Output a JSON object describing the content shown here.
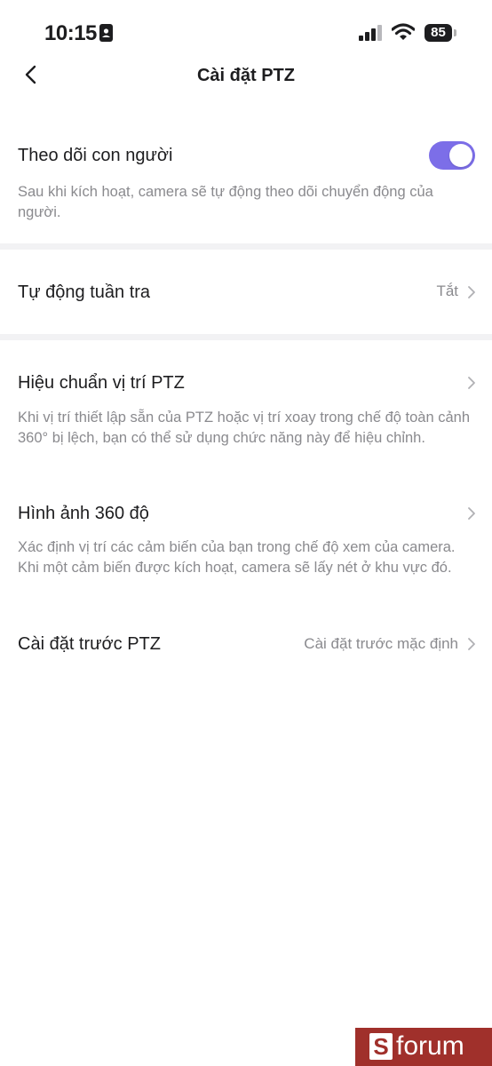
{
  "status_bar": {
    "time": "10:15",
    "battery": "85"
  },
  "nav": {
    "title": "Cài đặt PTZ"
  },
  "settings": {
    "human_tracking": {
      "title": "Theo dõi con người",
      "description": "Sau khi kích hoạt, camera sẽ tự động theo dõi chuyển động của người.",
      "enabled": true
    },
    "auto_patrol": {
      "title": "Tự động tuần tra",
      "value": "Tắt"
    },
    "ptz_calibration": {
      "title": "Hiệu chuẩn vị trí PTZ",
      "description": "Khi vị trí thiết lập sẵn của PTZ hoặc vị trí xoay trong chế độ toàn cảnh 360° bị lệch, bạn có thể sử dụng chức năng này để hiệu chỉnh."
    },
    "image_360": {
      "title": "Hình ảnh 360 độ",
      "description": "Xác định vị trí các cảm biến của bạn trong chế độ xem của camera. Khi một cảm biến được kích hoạt, camera sẽ lấy nét ở khu vực đó."
    },
    "ptz_presets": {
      "title": "Cài đặt trước PTZ",
      "value": "Cài đặt trước mặc định"
    }
  },
  "watermark": {
    "logo_letter": "S",
    "text": "forum"
  },
  "colors": {
    "toggle_on": "#7c6ee8",
    "watermark_bg": "#a0302b",
    "secondary_text": "#8a8a8e",
    "divider": "#f2f2f4"
  }
}
